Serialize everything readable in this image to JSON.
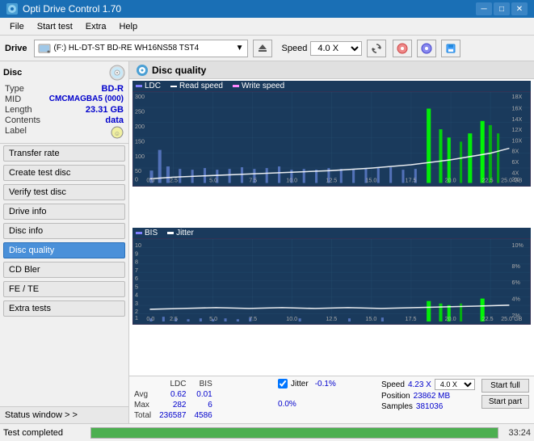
{
  "titlebar": {
    "title": "Opti Drive Control 1.70",
    "minimize": "─",
    "maximize": "□",
    "close": "✕"
  },
  "menubar": {
    "items": [
      "File",
      "Start test",
      "Extra",
      "Help"
    ]
  },
  "toolbar": {
    "drive_label": "Drive",
    "drive_value": "(F:)  HL-DT-ST BD-RE  WH16NS58 TST4",
    "speed_label": "Speed",
    "speed_value": "4.0 X"
  },
  "sidebar": {
    "disc_section_title": "Disc",
    "disc_type_label": "Type",
    "disc_type_value": "BD-R",
    "disc_mid_label": "MID",
    "disc_mid_value": "CMCMAGBA5 (000)",
    "disc_length_label": "Length",
    "disc_length_value": "23.31 GB",
    "disc_contents_label": "Contents",
    "disc_contents_value": "data",
    "disc_label_label": "Label",
    "buttons": [
      "Transfer rate",
      "Create test disc",
      "Verify test disc",
      "Drive info",
      "Disc info",
      "Disc quality",
      "CD Bler",
      "FE / TE",
      "Extra tests"
    ],
    "active_button": "Disc quality",
    "status_window": "Status window > >"
  },
  "disc_quality": {
    "title": "Disc quality",
    "chart1": {
      "legend": [
        "LDC",
        "Read speed",
        "Write speed"
      ],
      "y_max": 300,
      "y_labels": [
        "300",
        "250",
        "200",
        "150",
        "100",
        "50",
        "0"
      ],
      "y_right_labels": [
        "18X",
        "16X",
        "14X",
        "12X",
        "10X",
        "8X",
        "6X",
        "4X",
        "2X"
      ],
      "x_labels": [
        "0.0",
        "2.5",
        "5.0",
        "7.5",
        "10.0",
        "12.5",
        "15.0",
        "17.5",
        "20.0",
        "22.5",
        "25.0 GB"
      ]
    },
    "chart2": {
      "legend": [
        "BIS",
        "Jitter"
      ],
      "y_max": 10,
      "y_labels": [
        "10",
        "9",
        "8",
        "7",
        "6",
        "5",
        "4",
        "3",
        "2",
        "1"
      ],
      "y_right_labels": [
        "10%",
        "8%",
        "6%",
        "4%",
        "2%"
      ],
      "x_labels": [
        "0.0",
        "2.5",
        "5.0",
        "7.5",
        "10.0",
        "12.5",
        "15.0",
        "17.5",
        "20.0",
        "22.5",
        "25.0 GB"
      ]
    }
  },
  "stats": {
    "columns": [
      "",
      "LDC",
      "BIS",
      "",
      "Jitter",
      "Speed",
      "4.23 X",
      "4.0 X"
    ],
    "avg_label": "Avg",
    "avg_ldc": "0.62",
    "avg_bis": "0.01",
    "avg_jitter": "-0.1%",
    "max_label": "Max",
    "max_ldc": "282",
    "max_bis": "6",
    "max_jitter": "0.0%",
    "total_label": "Total",
    "total_ldc": "236587",
    "total_bis": "4586",
    "position_label": "Position",
    "position_value": "23862 MB",
    "samples_label": "Samples",
    "samples_value": "381036",
    "start_full": "Start full",
    "start_part": "Start part",
    "jitter_checked": true,
    "speed_label": "Speed",
    "speed_current": "4.23 X",
    "speed_select": "4.0 X"
  },
  "statusbar": {
    "status_text": "Test completed",
    "progress": 100,
    "time": "33:24"
  }
}
